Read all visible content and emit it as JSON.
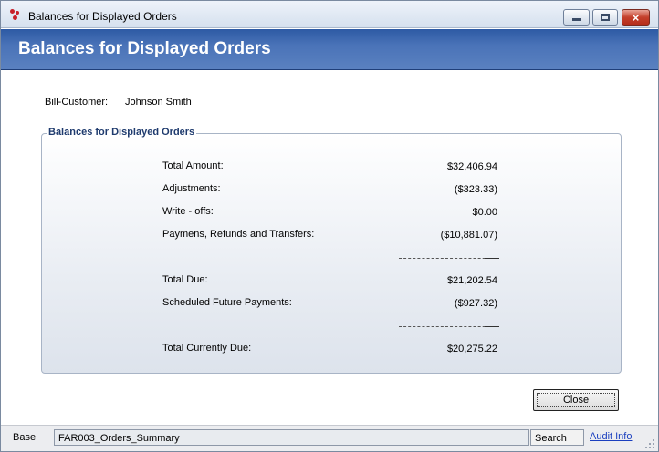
{
  "window": {
    "title": "Balances for Displayed Orders",
    "controls": {
      "minimize": "minimize",
      "maximize": "maximize",
      "close": "×"
    }
  },
  "banner": {
    "title": "Balances for Displayed Orders"
  },
  "customer": {
    "label": "Bill-Customer:",
    "value": "Johnson Smith"
  },
  "group": {
    "title": "Balances for Displayed Orders",
    "rows": [
      {
        "label": "Total Amount:",
        "value": "$32,406.94"
      },
      {
        "label": "Adjustments:",
        "value": "($323.33)"
      },
      {
        "label": "Write - offs:",
        "value": "$0.00"
      },
      {
        "label": "Paymens, Refunds and Transfers:",
        "value": "($10,881.07)"
      },
      {
        "label": "Total Due:",
        "value": "$21,202.54"
      },
      {
        "label": "Scheduled Future Payments:",
        "value": "($927.32)"
      },
      {
        "label": "Total Currently Due:",
        "value": "$20,275.22"
      }
    ]
  },
  "buttons": {
    "close": "Close"
  },
  "statusbar": {
    "base": "Base",
    "form": "FAR003_Orders_Summary",
    "search": "Search",
    "audit": "Audit Info"
  }
}
